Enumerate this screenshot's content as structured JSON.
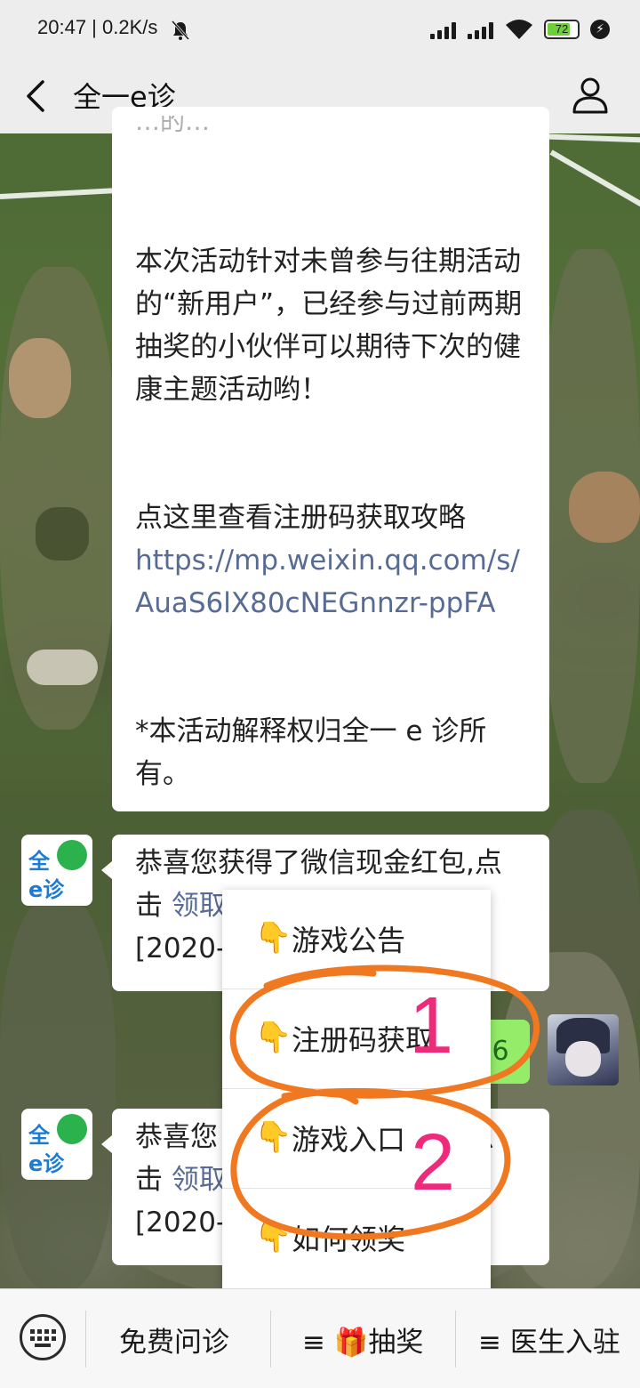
{
  "status_bar": {
    "time": "20:47",
    "network_speed": "0.2K/s",
    "battery_level": "72",
    "icons": [
      "mute-bell-icon",
      "signal-icon",
      "signal-icon",
      "wifi-icon",
      "battery-icon",
      "charging-icon"
    ]
  },
  "nav": {
    "title": "全一e诊",
    "back_icon": "chevron-left-icon",
    "profile_icon": "person-icon"
  },
  "messages": {
    "article": {
      "partial_top": "…的…",
      "para1": "本次活动针对未曾参与往期活动的“新用户”，已经参与过前两期抽奖的小伙伴可以期待下次的健康主题活动哟！",
      "para2": "点这里查看注册码获取攻略",
      "link": "https://mp.weixin.qq.com/s/AuaS6lX80cNEGnnzr-ppFA",
      "para3": "*本活动解释权归全一 e 诊所有。"
    },
    "msg2": {
      "line1": "恭喜您获得了微信现金红包,点",
      "line2_prefix": "击 ",
      "line2_link": "领取",
      "line3": "[2020-"
    },
    "msg3": {
      "line1_prefix": "恭喜您",
      "line1_suffix": ",点",
      "line2_prefix": "击 ",
      "line2_link": "领取",
      "line3": "[2020-"
    },
    "user_reply": "6",
    "avatar_text_top": "全",
    "avatar_text_bottom": "e诊"
  },
  "menu": {
    "items": [
      {
        "label": "游戏公告"
      },
      {
        "label": "注册码获取"
      },
      {
        "label": "游戏入口"
      },
      {
        "label": "如何领奖"
      }
    ],
    "hand_glyph": "👇"
  },
  "annotations": {
    "labels": [
      "1",
      "2"
    ],
    "color": "#f07820",
    "digit_color": "#ee2a7b"
  },
  "bottom_bar": {
    "keyboard_icon": "keyboard-icon",
    "items": [
      {
        "label": "免费问诊"
      },
      {
        "label": "≡ 🎁抽奖"
      },
      {
        "label": "≡ 医生入驻"
      }
    ]
  }
}
